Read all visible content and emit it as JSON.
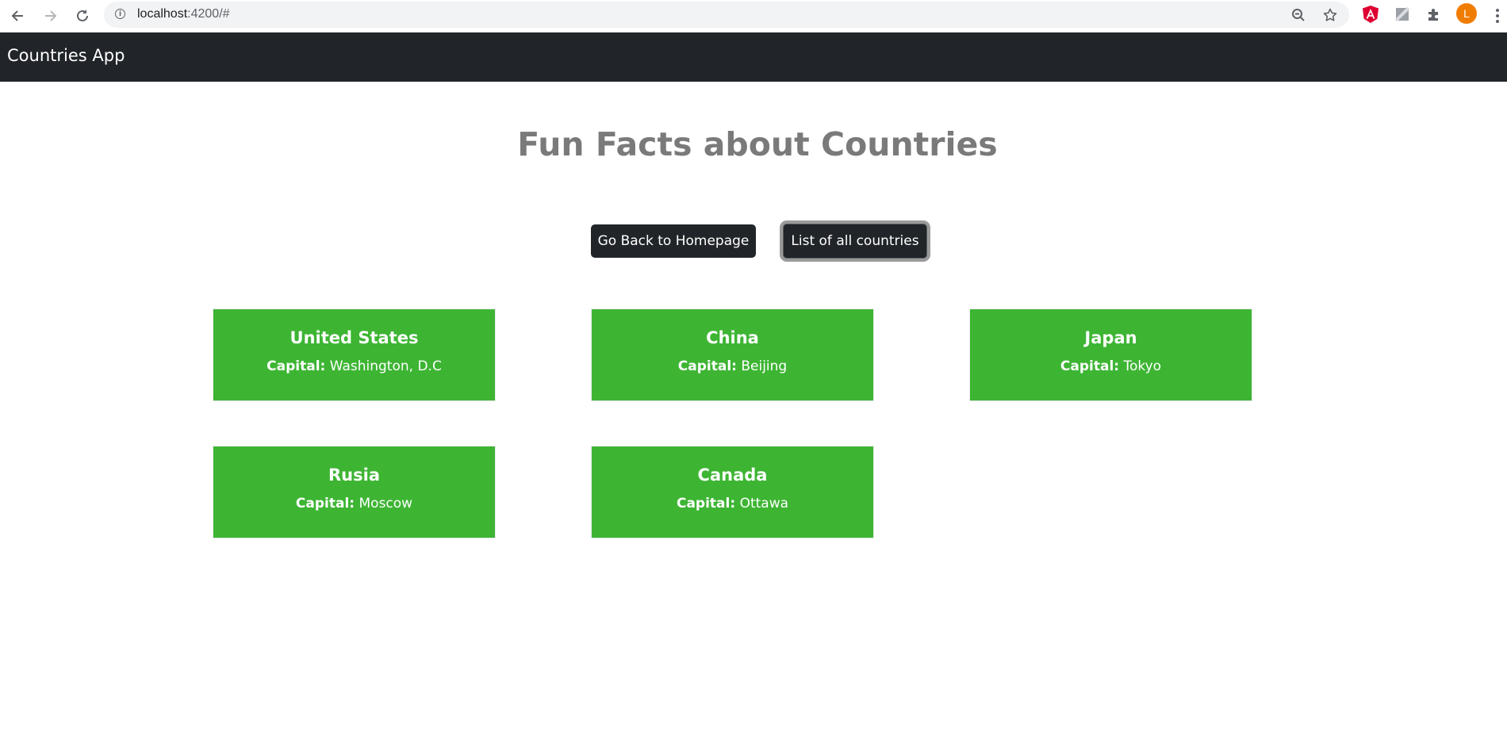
{
  "browser": {
    "url_host": "localhost",
    "url_rest": ":4200/#",
    "colors": {
      "avatar": "#f07c00",
      "angular": "#dd0031"
    },
    "icons": [
      "back-arrow-icon",
      "forward-arrow-icon",
      "reload-icon",
      "info-icon",
      "zoom-out-icon",
      "star-icon",
      "angular-extension-icon",
      "extension-square-icon",
      "puzzle-icon",
      "menu-dots-icon"
    ],
    "avatar_letter": "L"
  },
  "navbar": {
    "brand": "Countries App",
    "background": "#212529"
  },
  "page": {
    "title": "Fun Facts about Countries",
    "title_color": "#7a7a7a"
  },
  "buttons": {
    "home": "Go Back to Homepage",
    "list": "List of all countries"
  },
  "countries": [
    {
      "name": "United States",
      "capital_label": "Capital:",
      "capital": "Washington, D.C"
    },
    {
      "name": "China",
      "capital_label": "Capital:",
      "capital": "Beijing"
    },
    {
      "name": "Japan",
      "capital_label": "Capital:",
      "capital": "Tokyo"
    },
    {
      "name": "Rusia",
      "capital_label": "Capital:",
      "capital": "Moscow"
    },
    {
      "name": "Canada",
      "capital_label": "Capital:",
      "capital": "Ottawa"
    }
  ],
  "card_color": "#3db533"
}
